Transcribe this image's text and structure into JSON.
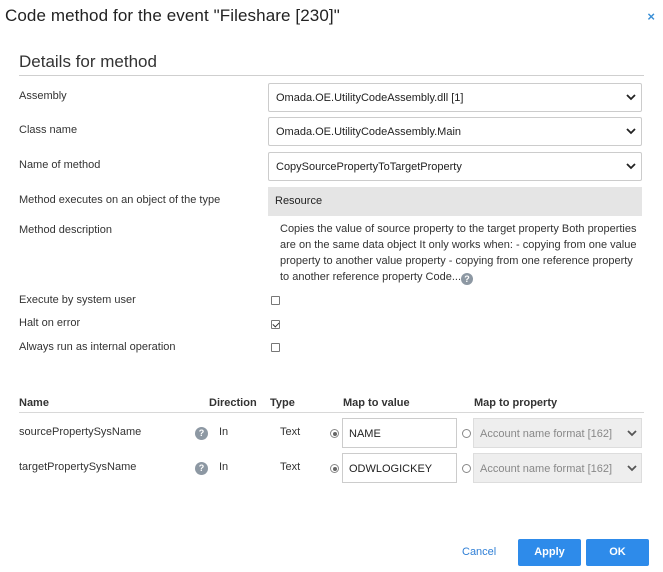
{
  "dialog": {
    "title": "Code method for the event \"Fileshare [230]\"",
    "close_glyph": "×"
  },
  "section": {
    "title": "Details for method"
  },
  "fields": {
    "assembly_label": "Assembly",
    "assembly_value": "Omada.OE.UtilityCodeAssembly.dll [1]",
    "class_label": "Class name",
    "class_value": "Omada.OE.UtilityCodeAssembly.Main",
    "method_label": "Name of method",
    "method_value": "CopySourcePropertyToTargetProperty",
    "object_type_label": "Method executes on an object of the type",
    "object_type_value": "Resource",
    "description_label": "Method description",
    "description_text": "Copies the value of source property to the target property Both properties are on the same data object It only works when: - copying from one value property to another value property - copying from one reference property to another reference property Code...",
    "help_glyph": "?"
  },
  "options": {
    "system_user_label": "Execute by system user",
    "system_user_checked": false,
    "halt_label": "Halt on error",
    "halt_checked": true,
    "internal_label": "Always run as internal operation",
    "internal_checked": false
  },
  "params": {
    "headers": {
      "name": "Name",
      "direction": "Direction",
      "type": "Type",
      "map_value": "Map to value",
      "map_property": "Map to property"
    },
    "rows": [
      {
        "name": "sourcePropertySysName",
        "direction": "In",
        "type": "Text",
        "value": "NAME",
        "value_selected": true,
        "property": "Account name format [162]"
      },
      {
        "name": "targetPropertySysName",
        "direction": "In",
        "type": "Text",
        "value": "ODWLOGICKEY",
        "value_selected": true,
        "property": "Account name format [162]"
      }
    ]
  },
  "footer": {
    "cancel_label": "Cancel",
    "apply_label": "Apply",
    "ok_label": "OK"
  },
  "colors": {
    "accent": "#2e8bea",
    "link": "#2f7fd6",
    "readonly_bg": "#e5e5e5"
  },
  "icons": {
    "close": "close-icon",
    "dropdown": "chevron-down-icon",
    "help": "help-icon"
  }
}
